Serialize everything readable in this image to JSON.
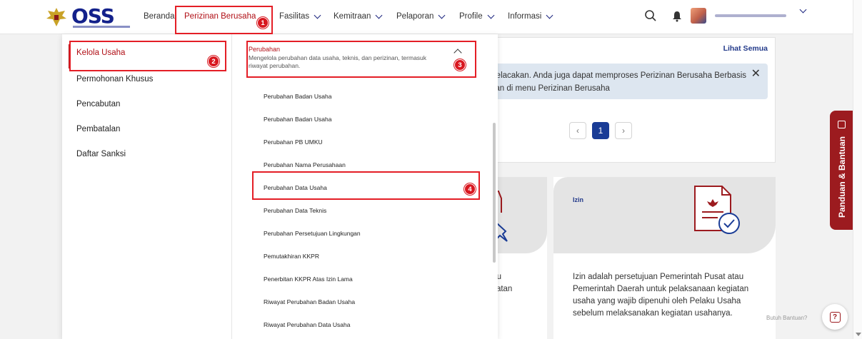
{
  "brand": {
    "logo_text": "OSS"
  },
  "nav": {
    "items": [
      {
        "label": "Beranda",
        "dropdown": false,
        "active": false
      },
      {
        "label": "Perizinan Berusaha",
        "dropdown": false,
        "active": true
      },
      {
        "label": "Fasilitas",
        "dropdown": true,
        "active": false
      },
      {
        "label": "Kemitraan",
        "dropdown": true,
        "active": false
      },
      {
        "label": "Pelaporan",
        "dropdown": true,
        "active": false
      },
      {
        "label": "Profile",
        "dropdown": true,
        "active": false
      },
      {
        "label": "Informasi",
        "dropdown": true,
        "active": false
      }
    ]
  },
  "menu": {
    "left_items": [
      "Kelola Usaha",
      "Permohonan Khusus",
      "Pencabutan",
      "Pembatalan",
      "Daftar Sanksi"
    ],
    "section": {
      "title": "Perubahan",
      "description": "Mengelola perubahan data usaha, teknis, dan perizinan, termasuk riwayat perubahan."
    },
    "sub_items": [
      "Perubahan Badan Usaha",
      "Perubahan Badan Usaha",
      "Perubahan PB UMKU",
      "Perubahan Nama Perusahaan",
      "Perubahan Data Usaha",
      "Perubahan Data Teknis",
      "Perubahan Persetujuan Lingkungan",
      "Pemutakhiran KKPR",
      "Penerbitan KKPR Atas Izin Lama",
      "Riwayat Perubahan Badan Usaha",
      "Riwayat Perubahan Data Usaha"
    ]
  },
  "background": {
    "lihat_semua": "Lihat Semua",
    "info_line1": "Pelacakan. Anda juga dapat memproses Perizinan Berusaha Berbasis",
    "info_line2": "gan di menu Perizinan Berusaha",
    "close_glyph": "✕",
    "pagination": {
      "prev": "‹",
      "current": "1",
      "next": "›"
    },
    "card2_lines": [
      "tau",
      "giatan"
    ],
    "izin_label": "Izin",
    "izin_desc": "Izin adalah persetujuan Pemerintah Pusat atau Pemerintah Daerah untuk pelaksanaan kegiatan usaha yang wajib dipenuhi oleh Pelaku Usaha sebelum melaksanakan kegiatan usahanya."
  },
  "side_tab": {
    "label": "Panduan & Bantuan"
  },
  "help": {
    "text": "Butuh Bantuan?",
    "icon": "?"
  },
  "annotations": [
    "1",
    "2",
    "3",
    "4"
  ],
  "colors": {
    "brand_blue": "#13218b",
    "accent_red": "#b00f16",
    "highlight": "#e41e26",
    "side_tab": "#9c1b1f"
  }
}
